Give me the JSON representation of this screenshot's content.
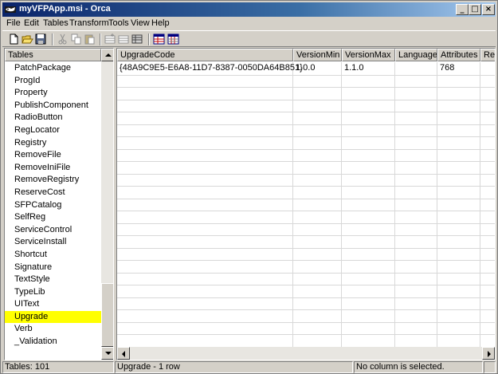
{
  "window": {
    "title": "myVFPApp.msi - Orca",
    "title_bar_color": "#0a246a",
    "controls": {
      "minimize": "_",
      "maximize": "□",
      "close": "×"
    }
  },
  "menu": {
    "items": [
      "File",
      "Edit",
      "Tables",
      "Transform",
      "Tools",
      "View",
      "Help"
    ]
  },
  "toolbar": {
    "buttons": [
      {
        "icon": "new-file-icon"
      },
      {
        "icon": "open-folder-icon"
      },
      {
        "icon": "save-disk-icon"
      },
      {
        "icon": "cut-icon"
      },
      {
        "icon": "copy-icon"
      },
      {
        "icon": "paste-icon"
      },
      {
        "icon": "add-row-icon"
      },
      {
        "icon": "drop-row-icon"
      },
      {
        "icon": "find-icon"
      },
      {
        "icon": "tables-grid-icon"
      },
      {
        "icon": "columns-grid-icon"
      }
    ]
  },
  "tables_pane": {
    "header": "Tables",
    "items": [
      "PatchPackage",
      "ProgId",
      "Property",
      "PublishComponent",
      "RadioButton",
      "RegLocator",
      "Registry",
      "RemoveFile",
      "RemoveIniFile",
      "RemoveRegistry",
      "ReserveCost",
      "SFPCatalog",
      "SelfReg",
      "ServiceControl",
      "ServiceInstall",
      "Shortcut",
      "Signature",
      "TextStyle",
      "TypeLib",
      "UIText",
      "Upgrade",
      "Verb",
      "_Validation"
    ],
    "selected": "Upgrade",
    "selected_color": "#ffff00"
  },
  "grid": {
    "columns": [
      "UpgradeCode",
      "VersionMin",
      "VersionMax",
      "Language",
      "Attributes",
      "Re"
    ],
    "rows": [
      [
        "{48A9C9E5-E6A8-11D7-8387-0050DA64B851}",
        "1.0.0",
        "1.1.0",
        "",
        "768",
        ""
      ]
    ]
  },
  "status": {
    "tables_count": "Tables: 101",
    "table_info": "Upgrade - 1 row",
    "column_info": "No column is selected."
  }
}
